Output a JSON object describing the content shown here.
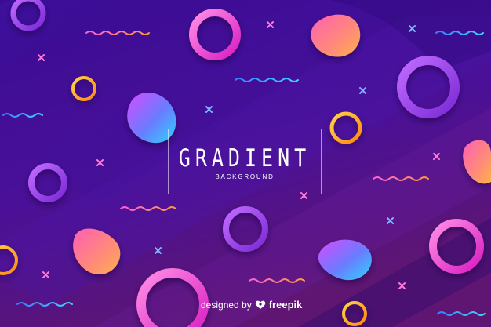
{
  "title": "GRADIENT",
  "subtitle": "BACKGROUND",
  "credit": {
    "prefix": "designed by",
    "brand": "freepik",
    "icon": "freepik-logo-icon"
  },
  "colors": {
    "background_top": "#3c0c8f",
    "background_bottom": "#5a1570",
    "pink": "#ff3fd0",
    "orange": "#ffa21c",
    "cyan": "#34c8ff",
    "violet": "#a44dff"
  }
}
